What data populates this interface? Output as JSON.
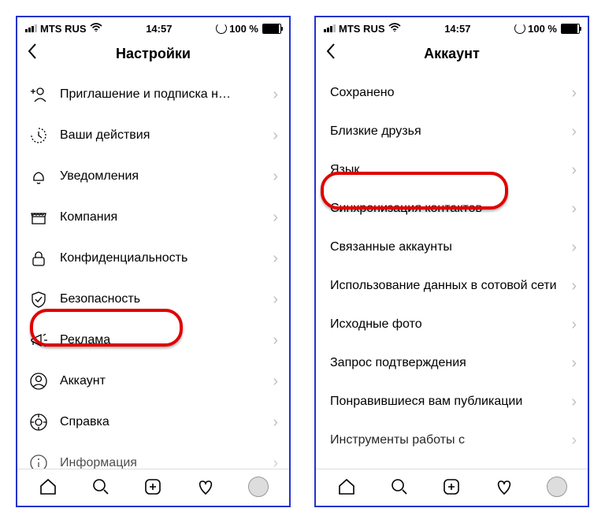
{
  "status": {
    "carrier": "MTS RUS",
    "time": "14:57",
    "battery": "100 %"
  },
  "left": {
    "title": "Настройки",
    "items": [
      {
        "label": "Приглашение и подписка н…"
      },
      {
        "label": "Ваши действия"
      },
      {
        "label": "Уведомления"
      },
      {
        "label": "Компания"
      },
      {
        "label": "Конфиденциальность"
      },
      {
        "label": "Безопасность"
      },
      {
        "label": "Реклама"
      },
      {
        "label": "Аккаунт"
      },
      {
        "label": "Справка"
      },
      {
        "label": "Информация"
      }
    ]
  },
  "right": {
    "title": "Аккаунт",
    "items": [
      {
        "label": "Сохранено"
      },
      {
        "label": "Близкие друзья"
      },
      {
        "label": "Язык"
      },
      {
        "label": "Синхронизация контактов"
      },
      {
        "label": "Связанные аккаунты"
      },
      {
        "label": "Использование данных в сотовой сети"
      },
      {
        "label": "Исходные фото"
      },
      {
        "label": "Запрос подтверждения"
      },
      {
        "label": "Понравившиеся вам публикации"
      },
      {
        "label": "Инструменты работы с"
      }
    ]
  }
}
